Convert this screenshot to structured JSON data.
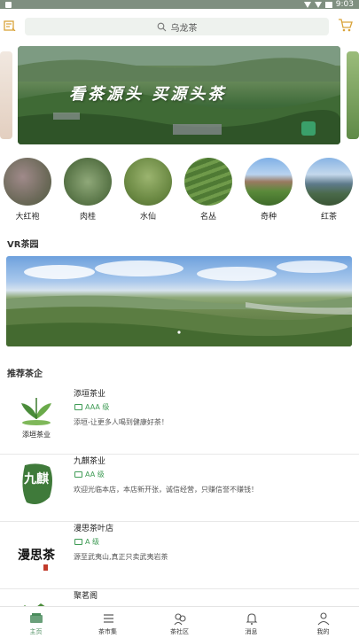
{
  "status_bar": {
    "time": "9:03"
  },
  "search": {
    "placeholder": "乌龙茶"
  },
  "banner": {
    "slogan": "看茶源头 买源头茶"
  },
  "categories": [
    {
      "label": "大红袍"
    },
    {
      "label": "肉桂"
    },
    {
      "label": "水仙"
    },
    {
      "label": "名丛"
    },
    {
      "label": "奇种"
    },
    {
      "label": "红茶"
    }
  ],
  "vr_section": {
    "title": "VR茶园"
  },
  "recommend": {
    "title": "推荐茶企"
  },
  "companies": [
    {
      "name": "添垣茶业",
      "grade": "AAA 级",
      "desc": "添垣-让更多人喝到健康好茶！",
      "logo_text": "添垣茶业"
    },
    {
      "name": "九麒茶业",
      "grade": "AA 级",
      "desc": "欢迎光临本店，本店新开张，诚信经营，只赚信誉不赚钱！",
      "logo_text": "九麒"
    },
    {
      "name": "漫思茶叶店",
      "grade": "A 级",
      "desc": "源至武夷山,真正只卖武夷岩茶",
      "logo_text": "漫思茶"
    },
    {
      "name": "聚茗阁",
      "grade": "",
      "desc": "",
      "logo_text": ""
    }
  ],
  "tabs": [
    {
      "label": "主页",
      "icon": "home-icon",
      "active": true
    },
    {
      "label": "茶市集",
      "icon": "list-icon",
      "active": false
    },
    {
      "label": "茶社区",
      "icon": "community-icon",
      "active": false
    },
    {
      "label": "消息",
      "icon": "bell-icon",
      "active": false
    },
    {
      "label": "我的",
      "icon": "person-icon",
      "active": false
    }
  ],
  "colors": {
    "accent": "#4a8c5c",
    "grade": "#3f9b55",
    "search_bg": "#eef2ee"
  }
}
